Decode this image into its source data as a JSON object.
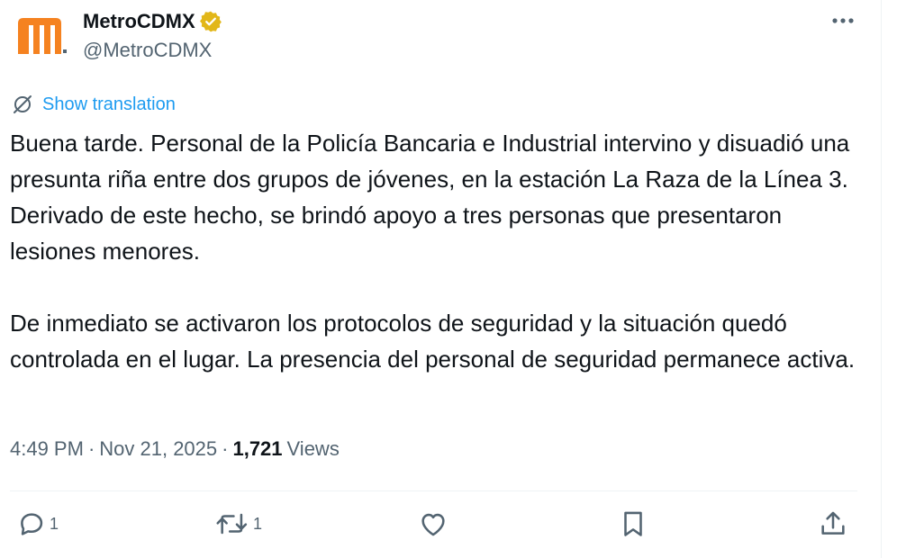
{
  "author": {
    "display_name": "MetroCDMX",
    "handle": "@MetroCDMX",
    "verified_badge": "gold-verified-badge-icon",
    "avatar_icon": "metro-cdmx-logo-icon",
    "brand_color": "#f58220",
    "badge_color": "#e2b719"
  },
  "menu": {
    "more_icon": "more-horizontal-icon"
  },
  "translation": {
    "icon": "globe-slash-icon",
    "label": "Show translation",
    "color": "#1d9bf0"
  },
  "tweet": {
    "paragraphs": [
      "Buena tarde. Personal de la Policía Bancaria e Industrial intervino y disuadió una presunta riña entre dos grupos de jóvenes, en la estación La Raza de la Línea 3. Derivado de este hecho, se brindó apoyo a tres personas que presentaron lesiones menores.",
      "De inmediato se activaron los protocolos de seguridad y la situación quedó controlada en el lugar. La presencia del personal de seguridad permanece activa."
    ]
  },
  "meta": {
    "time": "4:49 PM",
    "separator": "·",
    "date": "Nov 21, 2025",
    "views_count": "1,721",
    "views_label": "Views"
  },
  "actions": {
    "reply": {
      "icon": "reply-icon",
      "count": "1"
    },
    "retweet": {
      "icon": "retweet-icon",
      "count": "1"
    },
    "like": {
      "icon": "heart-icon"
    },
    "bookmark": {
      "icon": "bookmark-icon"
    },
    "share": {
      "icon": "share-icon"
    }
  }
}
